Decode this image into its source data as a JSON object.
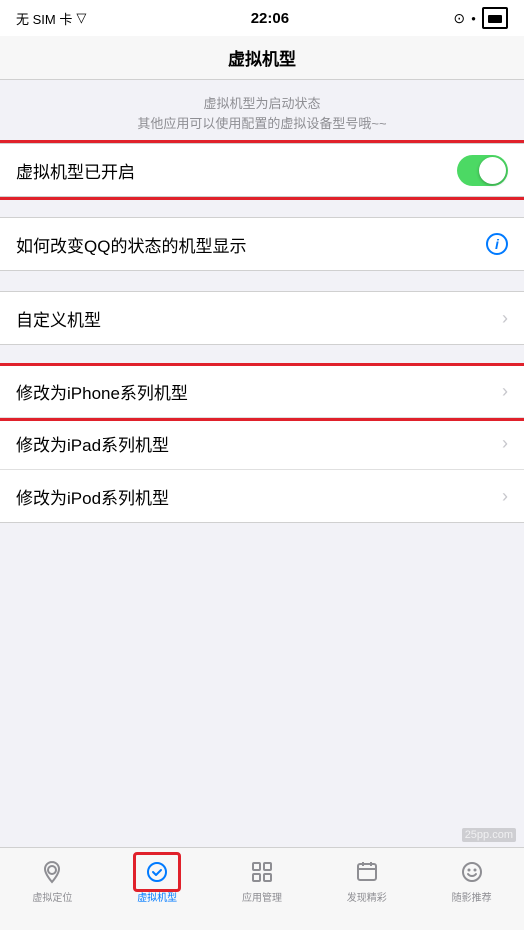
{
  "statusBar": {
    "left": "无 SIM 卡",
    "time": "22:06",
    "rightIcons": [
      "clock-icon",
      "dot-icon",
      "battery-icon"
    ]
  },
  "navBar": {
    "title": "虚拟机型"
  },
  "description": {
    "line1": "虚拟机型为启动状态",
    "line2": "其他应用可以使用配置的虚拟设备型号哦~~"
  },
  "sections": [
    {
      "id": "toggle-section",
      "rows": [
        {
          "label": "虚拟机型已开启",
          "type": "toggle",
          "value": true
        }
      ]
    },
    {
      "id": "info-section",
      "rows": [
        {
          "label": "如何改变QQ的状态的机型显示",
          "type": "info"
        }
      ]
    },
    {
      "id": "custom-section",
      "rows": [
        {
          "label": "自定义机型",
          "type": "chevron"
        }
      ]
    },
    {
      "id": "device-section",
      "rows": [
        {
          "label": "修改为iPhone系列机型",
          "type": "chevron",
          "highlighted": true
        },
        {
          "label": "修改为iPad系列机型",
          "type": "chevron"
        },
        {
          "label": "修改为iPod系列机型",
          "type": "chevron"
        }
      ]
    }
  ],
  "tabBar": {
    "items": [
      {
        "id": "virtual-location",
        "icon": "📍",
        "label": "虚拟定位",
        "active": false
      },
      {
        "id": "virtual-model",
        "icon": "✏️",
        "label": "虚拟机型",
        "active": true
      },
      {
        "id": "app-manage",
        "icon": "⊞",
        "label": "应用管理",
        "active": false
      },
      {
        "id": "discovery",
        "icon": "📅",
        "label": "发现精彩",
        "active": false
      },
      {
        "id": "recommend",
        "icon": "😊",
        "label": "随影推荐",
        "active": false
      }
    ]
  },
  "watermark": "25pp.com"
}
